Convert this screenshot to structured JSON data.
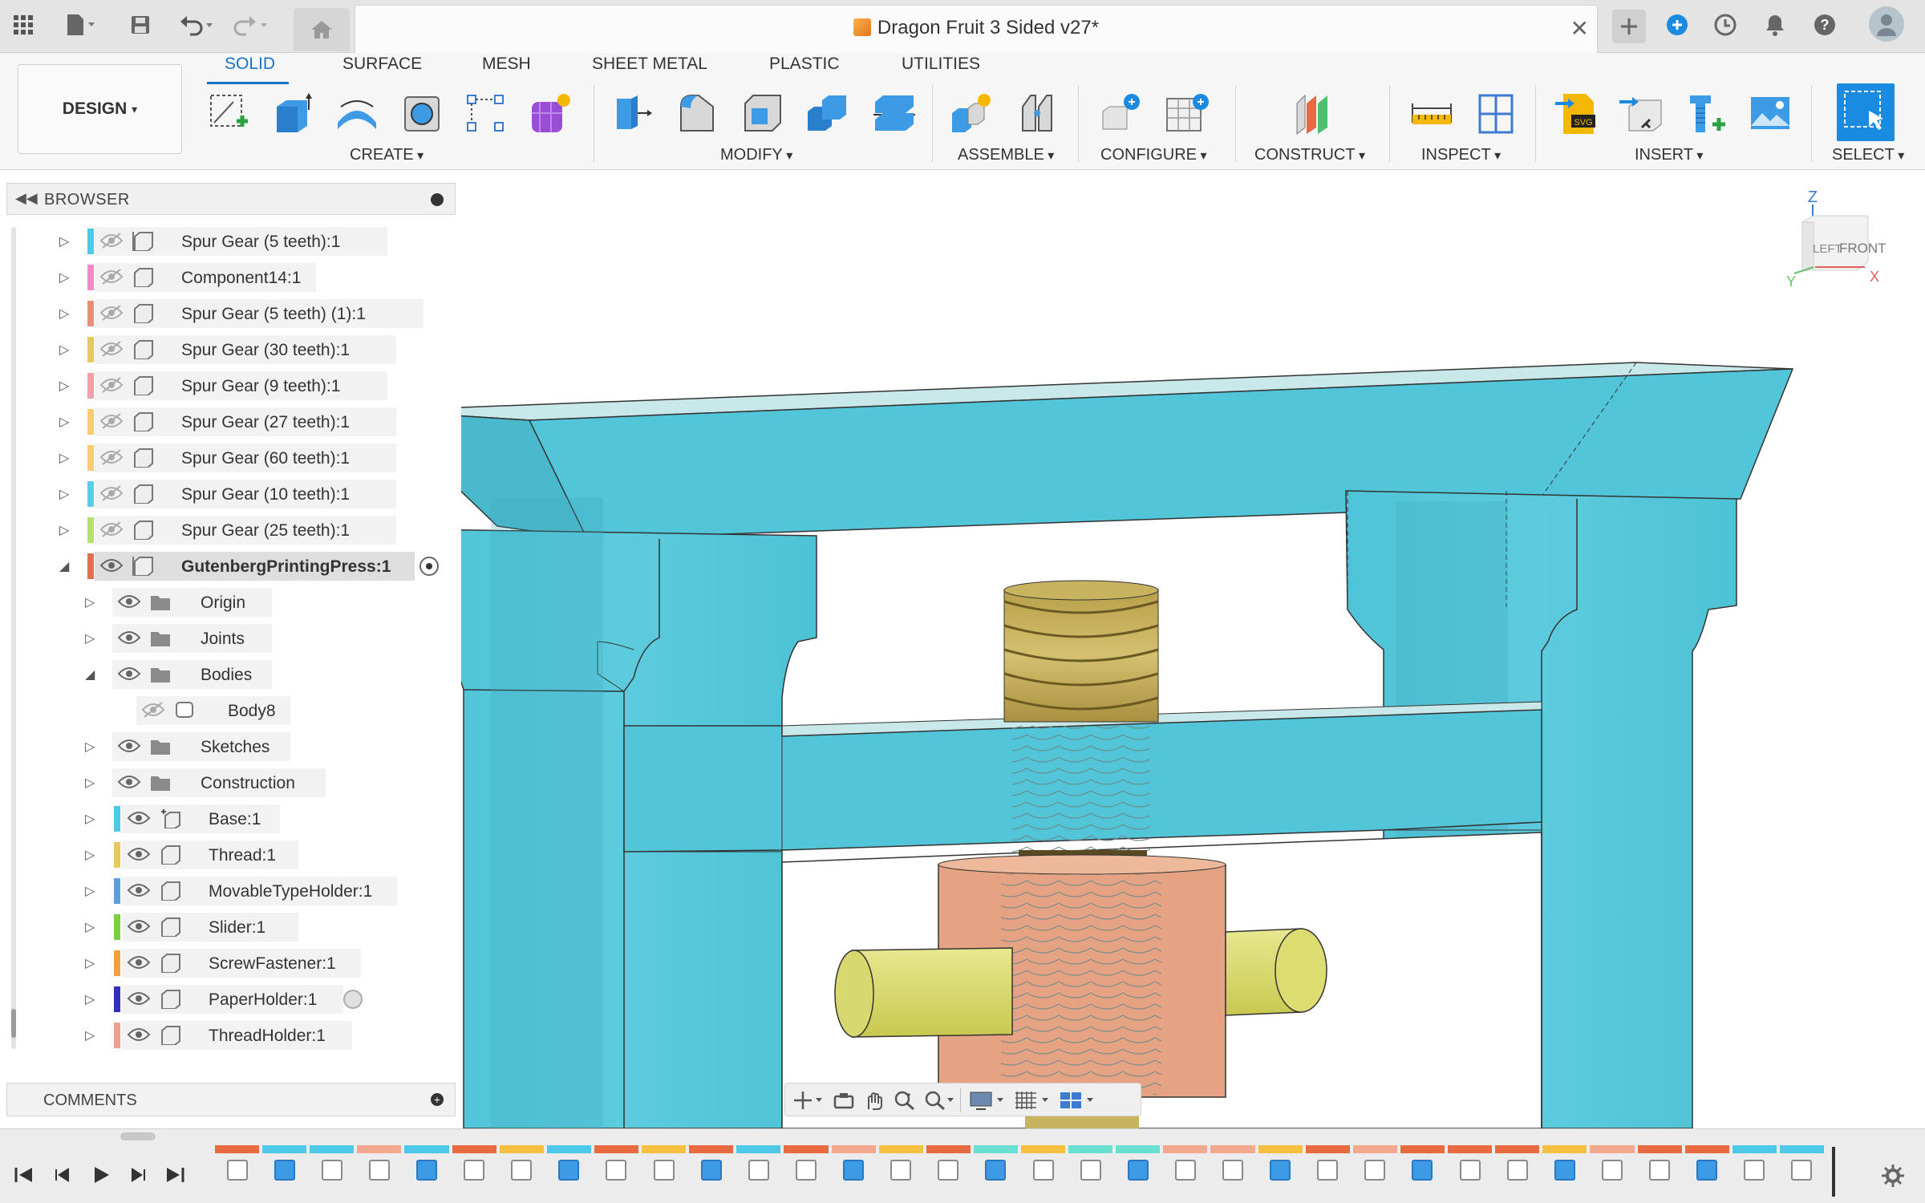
{
  "app": {
    "document_title": "Dragon Fruit 3 Sided v27*",
    "workspace": "DESIGN"
  },
  "ribbon": {
    "tabs": [
      "SOLID",
      "SURFACE",
      "MESH",
      "SHEET METAL",
      "PLASTIC",
      "UTILITIES"
    ],
    "active_tab": "SOLID",
    "groups": [
      "CREATE",
      "MODIFY",
      "ASSEMBLE",
      "CONFIGURE",
      "CONSTRUCT",
      "INSPECT",
      "INSERT",
      "SELECT"
    ]
  },
  "browser": {
    "title": "BROWSER",
    "items": [
      {
        "label": "Spur Gear (5 teeth):1",
        "color": "#4dc8e6",
        "visible": false,
        "expanded": false
      },
      {
        "label": "Component14:1",
        "color": "#f08cc4",
        "visible": false,
        "expanded": false
      },
      {
        "label": "Spur Gear (5 teeth) (1):1",
        "color": "#e8907a",
        "visible": false,
        "expanded": false
      },
      {
        "label": "Spur Gear (30 teeth):1",
        "color": "#e8c860",
        "visible": false,
        "expanded": false
      },
      {
        "label": "Spur Gear (9 teeth):1",
        "color": "#f0a0a8",
        "visible": false,
        "expanded": false
      },
      {
        "label": "Spur Gear (27 teeth):1",
        "color": "#f5cc70",
        "visible": false,
        "expanded": false
      },
      {
        "label": "Spur Gear (60 teeth):1",
        "color": "#f5cc70",
        "visible": false,
        "expanded": false
      },
      {
        "label": "Spur Gear (10 teeth):1",
        "color": "#58cfe0",
        "visible": false,
        "expanded": false
      },
      {
        "label": "Spur Gear (25 teeth):1",
        "color": "#b8e070",
        "visible": false,
        "expanded": false
      },
      {
        "label": "GutenbergPrintingPress:1",
        "color": "#e07050",
        "visible": true,
        "expanded": true,
        "active": true
      },
      {
        "label": "Origin",
        "visible": true,
        "expanded": false
      },
      {
        "label": "Joints",
        "visible": true,
        "expanded": false
      },
      {
        "label": "Bodies",
        "visible": true,
        "expanded": true
      },
      {
        "label": "Body8",
        "visible": false
      },
      {
        "label": "Sketches",
        "visible": true,
        "expanded": false
      },
      {
        "label": "Construction",
        "visible": true,
        "expanded": false
      },
      {
        "label": "Base:1",
        "color": "#4dc8e6",
        "visible": true,
        "expanded": false
      },
      {
        "label": "Thread:1",
        "color": "#e8c860",
        "visible": true,
        "expanded": false
      },
      {
        "label": "MovableTypeHolder:1",
        "color": "#5aa0e0",
        "visible": true,
        "expanded": false
      },
      {
        "label": "Slider:1",
        "color": "#78d040",
        "visible": true,
        "expanded": false
      },
      {
        "label": "ScrewFastener:1",
        "color": "#f0a040",
        "visible": true,
        "expanded": false
      },
      {
        "label": "PaperHolder:1",
        "color": "#3030b8",
        "visible": true,
        "expanded": false
      },
      {
        "label": "ThreadHolder:1",
        "color": "#f0a090",
        "visible": true,
        "expanded": false
      }
    ]
  },
  "comments": {
    "title": "COMMENTS"
  },
  "viewcube": {
    "faces": [
      "LEFT",
      "FRONT"
    ],
    "axes": [
      "Z",
      "Y",
      "X"
    ]
  },
  "colors": {
    "accent": "#1a73c8",
    "frame": "#4fc4d8",
    "thread": "#c9b45a",
    "holder": "#e8a080",
    "pin": "#dcdc70"
  },
  "timeline": {
    "segments": [
      "#e86a40",
      "#4dc8e6",
      "#4dc8e6",
      "#f5a890",
      "#4dc8e6",
      "#e86a40",
      "#f5c040",
      "#4dc8e6",
      "#e86a40",
      "#f5c040",
      "#e86a40",
      "#4dc8e6",
      "#e86a40",
      "#f5a890",
      "#f5c040",
      "#e86a40",
      "#6ae0d0",
      "#f5c040",
      "#6ae0d0",
      "#6ae0d0",
      "#f5a890",
      "#f5a890",
      "#f5c040",
      "#e86a40",
      "#f5a890",
      "#e86a40",
      "#e86a40",
      "#e86a40",
      "#f5c040",
      "#f5a890",
      "#e86a40",
      "#e86a40",
      "#4dc8e6",
      "#4dc8e6"
    ]
  }
}
